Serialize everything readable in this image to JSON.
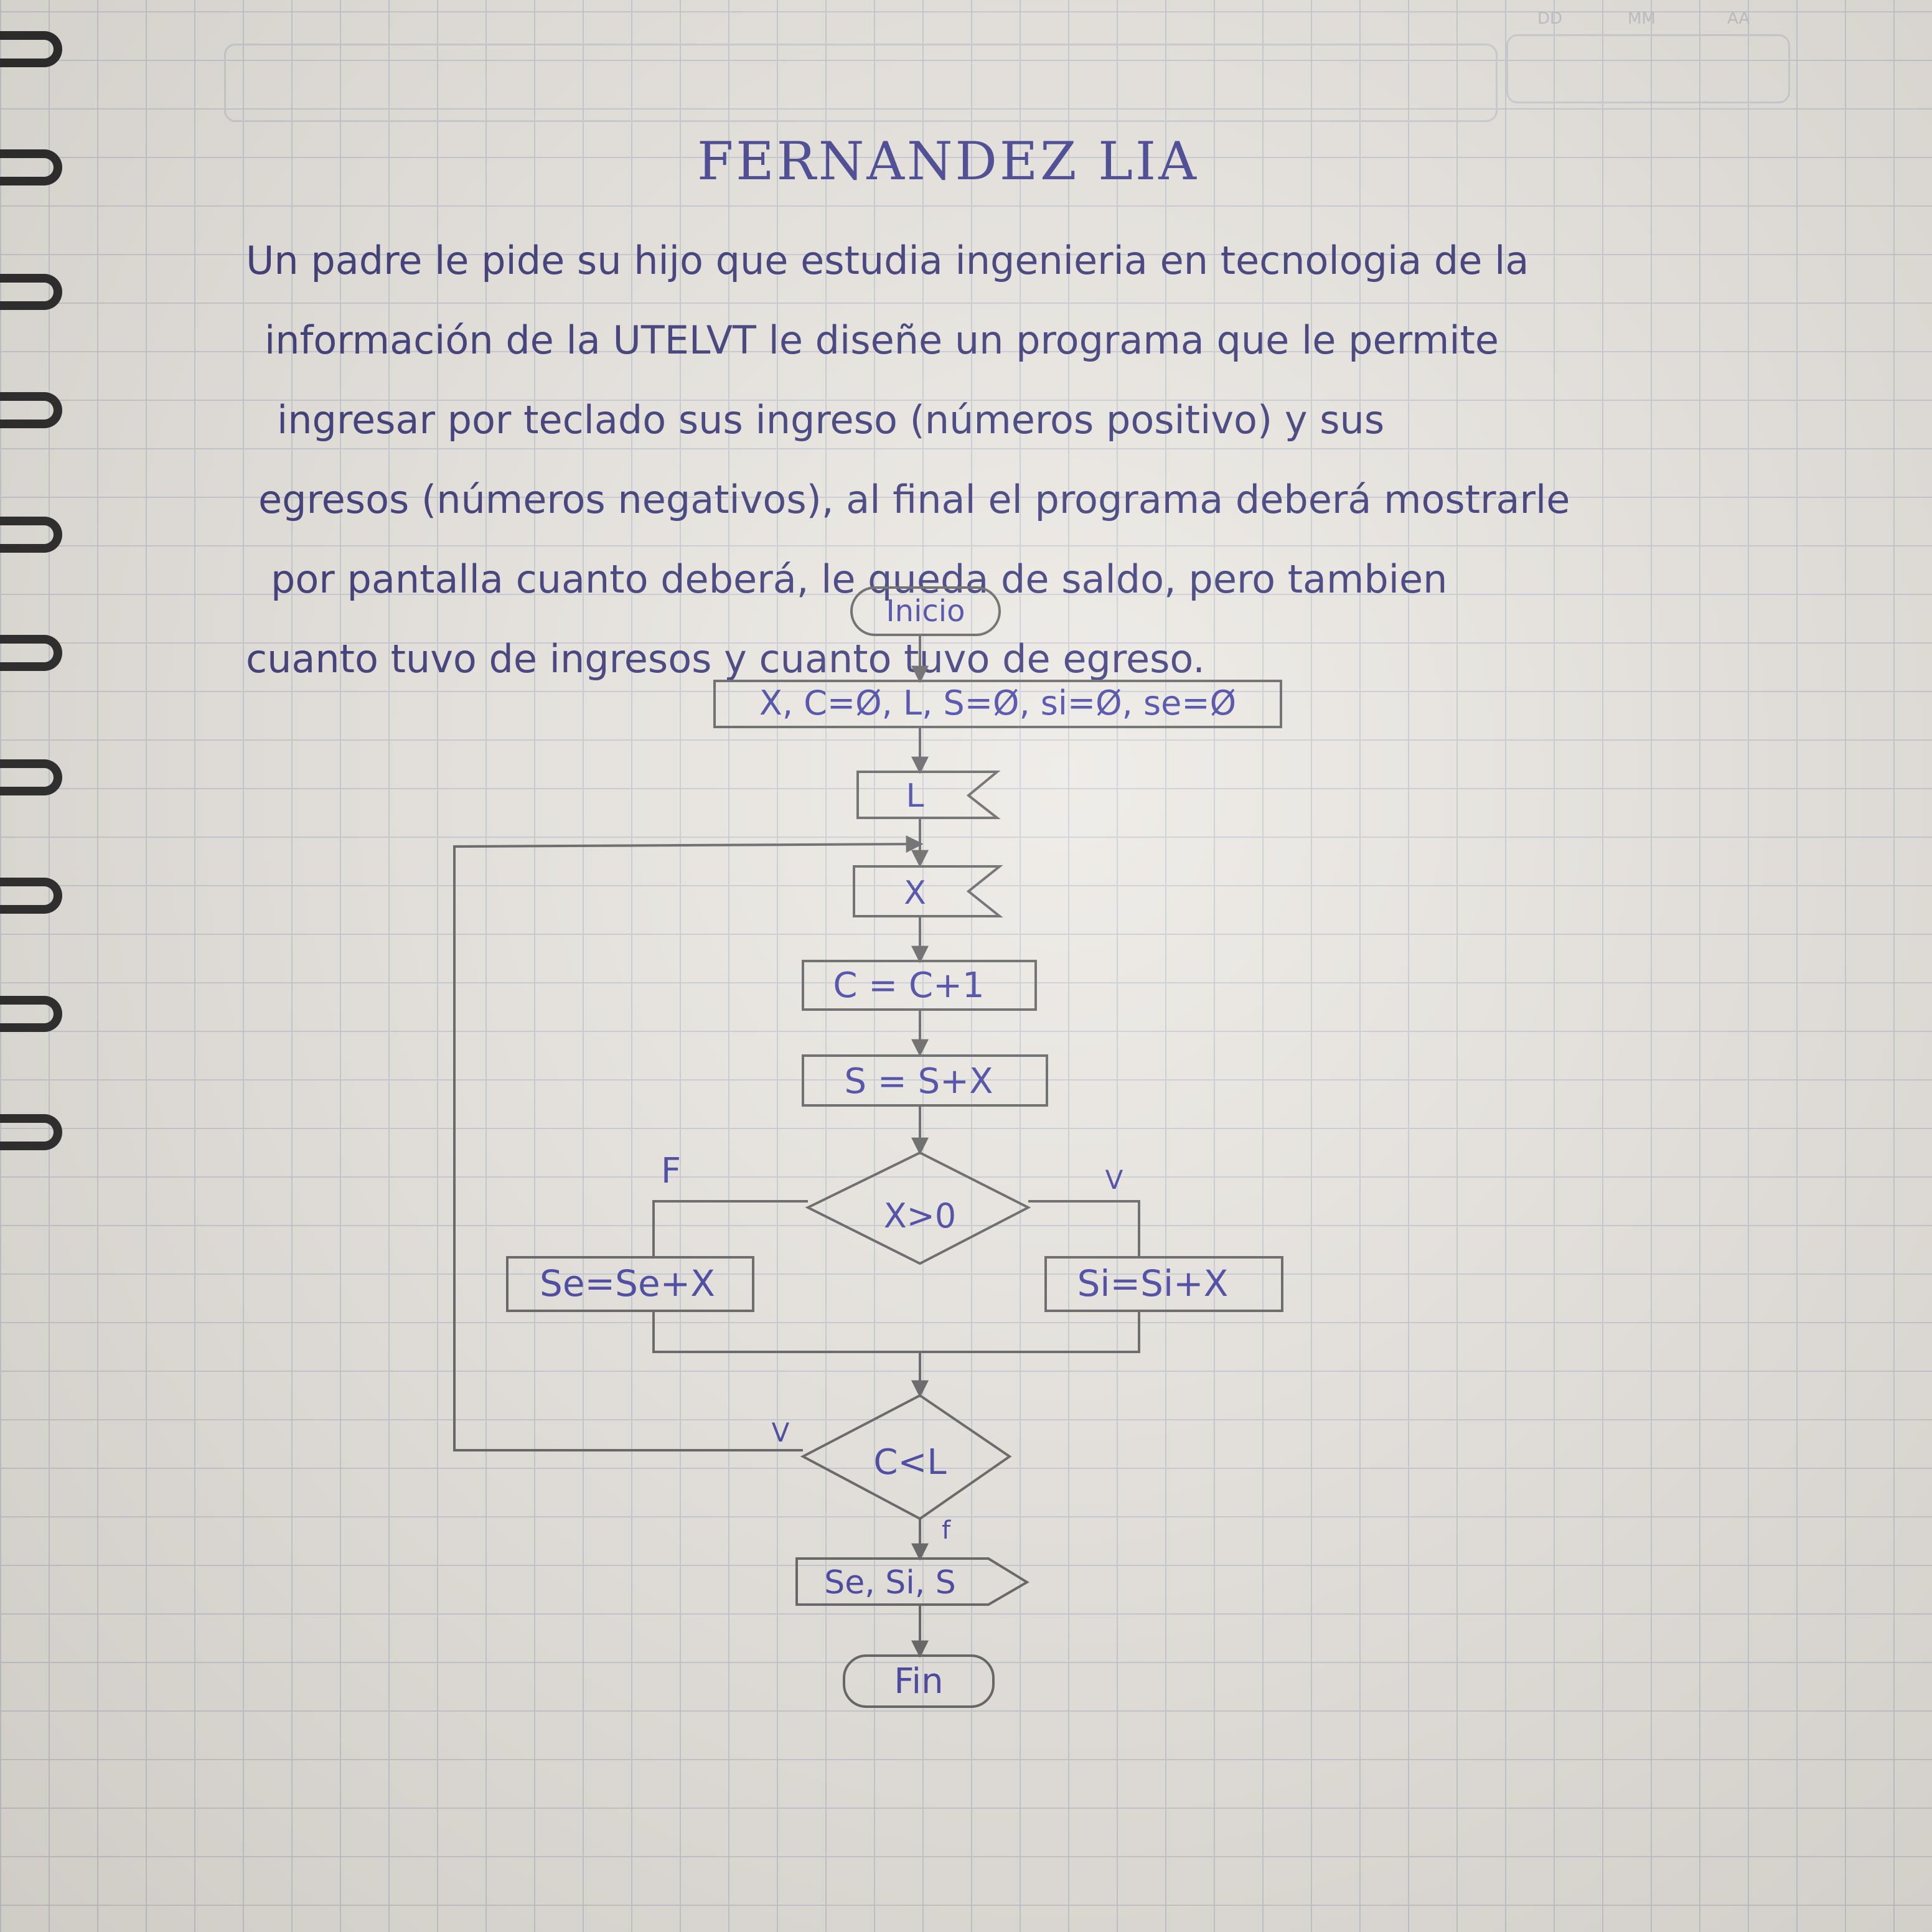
{
  "header": {
    "date_labels": [
      "DD",
      "MM",
      "AA"
    ]
  },
  "title": "FERNANDEZ LIA",
  "problem_statement": [
    "Un padre le pide su hijo que estudia ingenieria en tecnologia de la",
    "información de la UTELVT le diseñe un programa que le permite",
    "ingresar por teclado sus ingreso (números positivo) y sus",
    "egresos (números negativos), al final el programa deberá mostrarle",
    "por pantalla cuanto deberá, le queda de saldo, pero tambien",
    "cuanto tuvo de ingresos y cuanto tuvo de egreso."
  ],
  "flowchart": {
    "start": "Inicio",
    "init": "X, C=Ø, L, S=Ø, si=Ø, se=Ø",
    "input_l": "L",
    "input_x": "X",
    "counter": "C = C+1",
    "sum": "S = S+X",
    "decision_1": "X>0",
    "false_label": "F",
    "true_label": "V",
    "false_branch": "Se=Se+X",
    "true_branch": "Si=Si+X",
    "decision_2": "C<L",
    "loop_label": "V",
    "exit_label": "f",
    "output": "Se, Si, S",
    "end": "Fin"
  },
  "colors": {
    "ink_blue": "#3b3aa0",
    "pencil": "#5c5c5e",
    "grid": "#c9cdd4"
  }
}
